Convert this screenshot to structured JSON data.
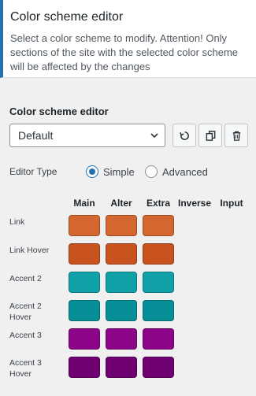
{
  "header": {
    "title": "Color scheme editor",
    "description": "Select a color scheme to modify. Attention! Only sections of the site with the selected color scheme will be affected by the changes"
  },
  "editor": {
    "section_title": "Color scheme editor",
    "scheme_select": {
      "value": "Default"
    },
    "editor_type_label": "Editor Type",
    "editor_type_options": [
      {
        "label": "Simple",
        "checked": true
      },
      {
        "label": "Advanced",
        "checked": false
      }
    ],
    "columns": [
      "Main",
      "Alter",
      "Extra",
      "Inverse",
      "Input"
    ],
    "rows": [
      {
        "label": "Link",
        "colors": [
          "#d3672f",
          "#d3672f",
          "#d3672f"
        ]
      },
      {
        "label": "Link Hover",
        "colors": [
          "#c9531f",
          "#c9531f",
          "#c9531f"
        ]
      },
      {
        "label": "Accent 2",
        "colors": [
          "#10a1a8",
          "#10a1a8",
          "#10a1a8"
        ]
      },
      {
        "label": "Accent 2 Hover",
        "colors": [
          "#068f96",
          "#068f96",
          "#068f96"
        ]
      },
      {
        "label": "Accent 3",
        "colors": [
          "#8c0487",
          "#8c0487",
          "#8c0487"
        ]
      },
      {
        "label": "Accent 3 Hover",
        "colors": [
          "#6e0071",
          "#6e0071",
          "#6e0071"
        ]
      }
    ]
  },
  "icons": {
    "reset": "reset-icon",
    "copy": "copy-icon",
    "delete": "trash-icon"
  }
}
